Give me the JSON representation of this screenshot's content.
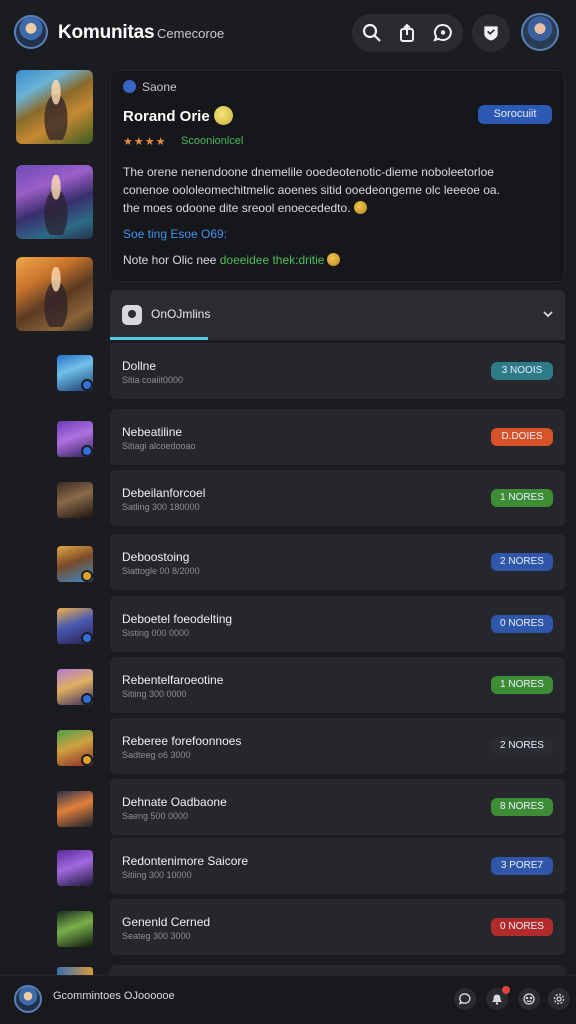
{
  "header": {
    "title": "Komunitas",
    "subtitle": "Cemecoroe",
    "icons": [
      "search-icon",
      "share-icon",
      "chat-icon",
      "shield-icon"
    ]
  },
  "featured": {
    "tag": "Saone",
    "title": "Rorand Orie",
    "button": "Sorocuiit",
    "stars": "★★★★",
    "rating_text": "Scoonionlcel",
    "description_lines": [
      "The orene nenendoone dnemelile ooedeotenotic-dieme noboleetorloe",
      "conenoe oololeomechitmelic aoenes sitid ooedeongeme olc leeeoe oa.",
      "the moes odoone dite sreool enoecededto."
    ],
    "link": "Soe ting Esoe O69:",
    "note_prefix": "Note hor Olic nee",
    "note_highlight": "doeeidee thek:dritie"
  },
  "section": {
    "title": "OnOJmlins"
  },
  "rows": [
    {
      "name": "Dollne",
      "meta": "Sitia coaiit0000",
      "pill": "3 NOOIS",
      "pill_color": "#2d7b86"
    },
    {
      "name": "Nebeatiline",
      "meta": "Sitiagi alcoedooao",
      "pill": "D.DOIES",
      "pill_color": "#d85428"
    },
    {
      "name": "Debeilanforcoel",
      "meta": "Satling 300 180000",
      "pill": "1 NORES",
      "pill_color": "#3f8c36"
    },
    {
      "name": "Deboostoing",
      "meta": "Siattogle 00 8/2000",
      "pill": "2 NORES",
      "pill_color": "#2f56a8"
    },
    {
      "name": "Deboetel foeodelting",
      "meta": "Sisting 000 0000",
      "pill": "0 NORES",
      "pill_color": "#2f56a8"
    },
    {
      "name": "Rebentelfaroeotine",
      "meta": "Sitiing 300 0000",
      "pill": "1 NORES",
      "pill_color": "#3f8c36"
    },
    {
      "name": "Reberee forefoonnoes",
      "meta": "Sadteeg o6 3000",
      "pill": "2 NORES",
      "pill_color": "#2b2c31"
    },
    {
      "name": "Dehnate Oadbaone",
      "meta": "Saeng 500 0000",
      "pill": "8 NORES",
      "pill_color": "#3f8c36"
    },
    {
      "name": "Redontenimore Saicore",
      "meta": "Sitiing 300 10000",
      "pill": "3 PORE7",
      "pill_color": "#2f56a8"
    },
    {
      "name": "Genenld Cerned",
      "meta": "Seateg 300 3000",
      "pill": "0 NORES",
      "pill_color": "#b22b2b"
    }
  ],
  "bottom": {
    "status": "Gcommintoes OJoooooe",
    "icons": [
      "chat-icon",
      "notification-icon",
      "emoji-icon",
      "settings-icon"
    ]
  }
}
